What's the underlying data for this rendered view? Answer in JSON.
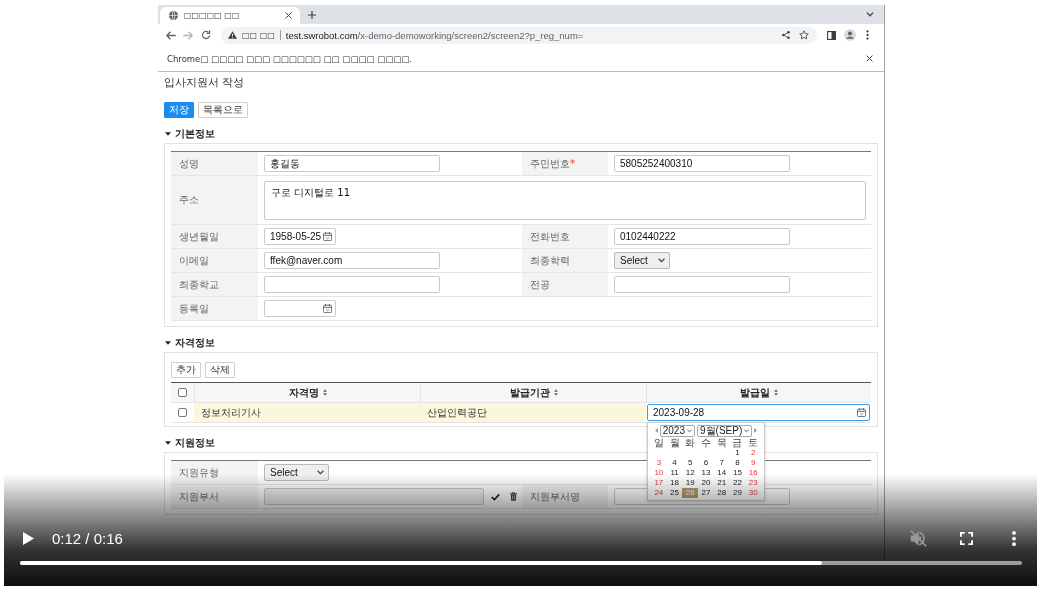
{
  "browser": {
    "tab": {
      "title": "□□□□□ □□"
    },
    "address_bar": {
      "security_label": "□□ □□",
      "url_host": "test.swrobot.com",
      "url_path": "/x-demo-demoworking/screen2/screen2?p_reg_num="
    },
    "infobar": {
      "message": "Chrome□ □□□□ □□□ □□□□□□ □□ □□□□ □□□□."
    }
  },
  "page": {
    "title": "입사지원서 작성",
    "buttons": [
      {
        "label": "저장",
        "kind": "primary"
      },
      {
        "label": "목록으로",
        "kind": "default"
      }
    ],
    "basic_info": {
      "title": "기본정보",
      "expanded": true,
      "rows": [
        [
          {
            "label": "성명",
            "kind": "text",
            "value": "홍길동",
            "disabled": false
          },
          {
            "label": "주민번호",
            "required_mark": "*",
            "kind": "text",
            "value": "5805252400310",
            "disabled": false
          }
        ],
        [
          {
            "label": "주소",
            "kind": "textarea",
            "value": "구로 디지털로 11",
            "disabled": false
          }
        ],
        [
          {
            "label": "생년월일",
            "kind": "date",
            "value": "1958-05-25",
            "disabled": false
          },
          {
            "label": "전화번호",
            "kind": "text",
            "value": "0102440222",
            "disabled": false
          }
        ],
        [
          {
            "label": "이메일",
            "kind": "text",
            "value": "ffek@naver.com",
            "disabled": false
          },
          {
            "label": "최종학력",
            "kind": "select",
            "value": "Select",
            "disabled": false
          }
        ],
        [
          {
            "label": "최종학교",
            "kind": "text",
            "disabled": false
          },
          {
            "label": "전공",
            "kind": "text",
            "disabled": false
          }
        ],
        [
          {
            "label": "등록일",
            "kind": "date",
            "disabled": false
          }
        ]
      ]
    },
    "qualifications": {
      "title": "자격정보",
      "expanded": true,
      "buttons": [
        "추가",
        "삭제"
      ],
      "table": {
        "all_checked": false,
        "columns": [
          {
            "label": "자격명",
            "sortable": true
          },
          {
            "label": "발급기관",
            "sortable": true
          },
          {
            "label": "발급일",
            "sortable": true
          }
        ],
        "rows": [
          {
            "checked": false,
            "selected": true,
            "cells": [
              {
                "kind": "text",
                "value": "정보처리기사"
              },
              {
                "kind": "text",
                "value": "산업인력공단"
              },
              {
                "kind": "date",
                "value": "2023-09-28",
                "focused": true
              }
            ]
          }
        ]
      },
      "datepicker": {
        "year": "2023",
        "month": "9월(SEP)",
        "weekdays": [
          "일",
          "월",
          "화",
          "수",
          "목",
          "금",
          "토"
        ],
        "weeks": [
          [
            {
              "label": "1",
              "weekend": false,
              "selected": false
            },
            {
              "label": "2",
              "weekend": true,
              "selected": false
            }
          ],
          [
            {
              "label": "3",
              "weekend": true,
              "selected": false
            },
            {
              "label": "4",
              "weekend": false,
              "selected": false
            },
            {
              "label": "5",
              "weekend": false,
              "selected": false
            },
            {
              "label": "6",
              "weekend": false,
              "selected": false
            },
            {
              "label": "7",
              "weekend": false,
              "selected": false
            },
            {
              "label": "8",
              "weekend": false,
              "selected": false
            },
            {
              "label": "9",
              "weekend": true,
              "selected": false
            }
          ],
          [
            {
              "label": "10",
              "weekend": true,
              "selected": false
            },
            {
              "label": "11",
              "weekend": false,
              "selected": false
            },
            {
              "label": "12",
              "weekend": false,
              "selected": false
            },
            {
              "label": "13",
              "weekend": false,
              "selected": false
            },
            {
              "label": "14",
              "weekend": false,
              "selected": false
            },
            {
              "label": "15",
              "weekend": false,
              "selected": false
            },
            {
              "label": "16",
              "weekend": true,
              "selected": false
            }
          ],
          [
            {
              "label": "17",
              "weekend": true,
              "selected": false
            },
            {
              "label": "18",
              "weekend": false,
              "selected": false
            },
            {
              "label": "19",
              "weekend": false,
              "selected": false
            },
            {
              "label": "20",
              "weekend": false,
              "selected": false
            },
            {
              "label": "21",
              "weekend": false,
              "selected": false
            },
            {
              "label": "22",
              "weekend": false,
              "selected": false
            },
            {
              "label": "23",
              "weekend": true,
              "selected": false
            }
          ],
          [
            {
              "label": "24",
              "weekend": true,
              "selected": false
            },
            {
              "label": "25",
              "weekend": false,
              "selected": false
            },
            {
              "label": "26",
              "weekend": false,
              "selected": true
            },
            {
              "label": "27",
              "weekend": false,
              "selected": false
            },
            {
              "label": "28",
              "weekend": false,
              "selected": false
            },
            {
              "label": "29",
              "weekend": false,
              "selected": false
            },
            {
              "label": "30",
              "weekend": true,
              "selected": false
            }
          ]
        ]
      }
    },
    "application": {
      "title": "지원정보",
      "expanded": true,
      "rows": [
        [
          {
            "label": "지원유형",
            "kind": "select",
            "value": "Select",
            "disabled": false
          }
        ],
        [
          {
            "label": "지원부서",
            "kind": "lookup",
            "disabled": true
          },
          {
            "label": "지원부서명",
            "kind": "text",
            "disabled": false
          }
        ]
      ]
    }
  },
  "video_controls": {
    "playing": false,
    "time": "0:12 / 0:16",
    "muted": true,
    "progress": {
      "level": 0.8
    }
  }
}
